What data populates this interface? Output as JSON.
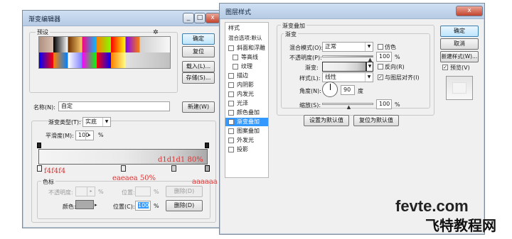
{
  "gradient_editor": {
    "title": "渐变编辑器",
    "min_label": "_",
    "max_label": "□",
    "close_label": "x",
    "presets_label": "预设",
    "gear_glyph": "✲",
    "ok": "确定",
    "reset": "复位",
    "load": "载入(L)...",
    "save": "存储(S)...",
    "name_label": "名称(N):",
    "name_value": "自定",
    "new": "新建(W)",
    "type_label": "渐变类型(T):",
    "type_value": "实底",
    "smooth_label": "平滑度(M):",
    "smooth_value": "100",
    "percent": "%",
    "color_stop_group": "色标",
    "opacity_label": "不透明度:",
    "opacity_value": "",
    "position_label": "位置:",
    "position_value": "",
    "delete_label": "删除(D)",
    "color_label": "颜色:",
    "position_c_label": "位置(C):",
    "position_c_value": "100",
    "delete2_label": "删除(D)",
    "gradient_colors": [
      "#f4f4f4",
      "#eaeaea",
      "#d1d1d1",
      "#aaaaaa"
    ]
  },
  "layer_style": {
    "title": "图层样式",
    "close_label": "x",
    "styles_label": "样式",
    "blend_options": "混合选项:默认",
    "items": [
      "斜面和浮雕",
      "等高线",
      "纹理",
      "描边",
      "内阴影",
      "内发光",
      "光泽",
      "颜色叠加",
      "渐变叠加",
      "图案叠加",
      "外发光",
      "投影"
    ],
    "checked_item": "渐变叠加",
    "ok": "确定",
    "cancel": "取消",
    "new_style": "新建样式(W)...",
    "preview": "预览(V)",
    "section_title": "渐变叠加",
    "sub_title": "渐变",
    "blend_mode_label": "混合模式(O):",
    "blend_mode_value": "正常",
    "dither": "仿色",
    "opacity_label": "不透明度(P):",
    "opacity_value": "100",
    "gradient_label": "渐变:",
    "reverse": "反向(R)",
    "style_label": "样式(L):",
    "style_value": "线性",
    "align": "与图层对齐(I)",
    "angle_label": "角度(N):",
    "angle_value": "90",
    "angle_unit": "度",
    "scale_label": "缩放(S):",
    "scale_value": "100",
    "percent": "%",
    "make_default": "设置为默认值",
    "reset_default": "复位为默认值"
  },
  "annotations": {
    "a1": "f4f4f4",
    "a2": "eaeaea 50%",
    "a3": "d1d1d1 80%",
    "a4": "aaaaaa"
  },
  "watermark": {
    "site": "fevte.com",
    "name": "飞特教程网"
  }
}
